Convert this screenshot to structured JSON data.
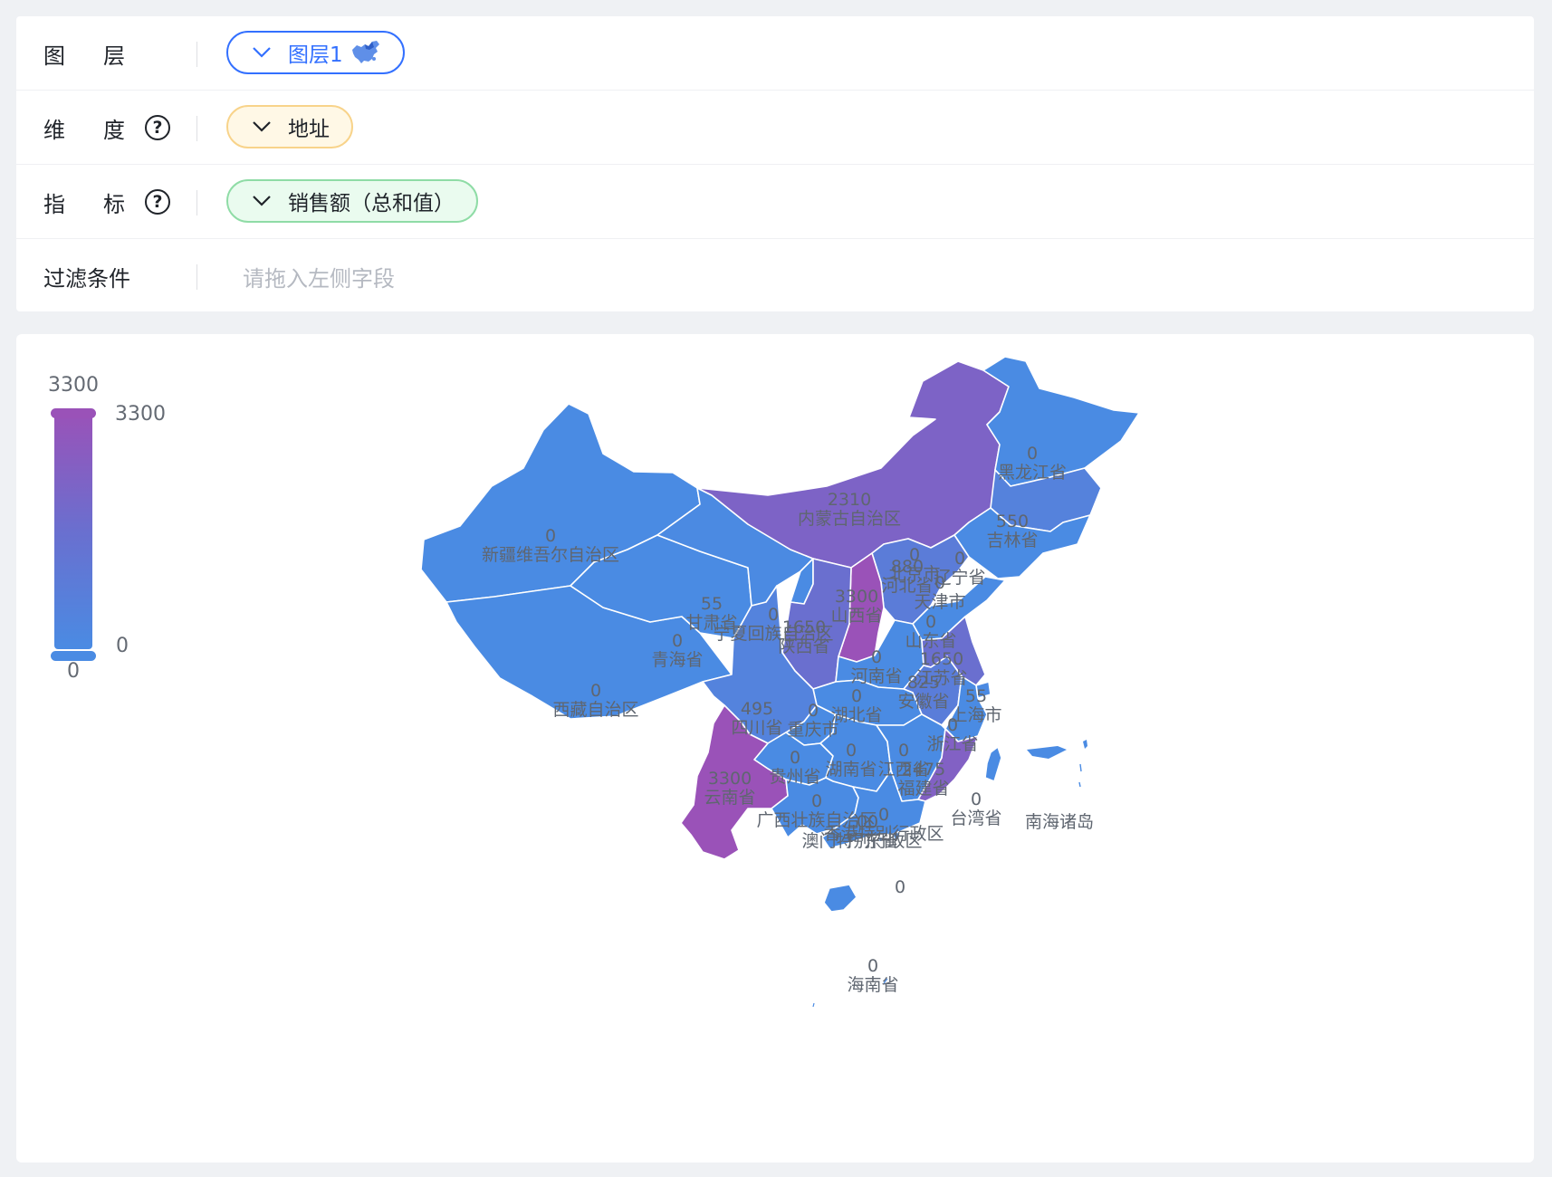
{
  "config": {
    "layer": {
      "label": "图层",
      "value": "图层1",
      "icon": "china-map-icon"
    },
    "dimension": {
      "label": "维度",
      "value": "地址",
      "help_icon": "question-circle-icon"
    },
    "metric": {
      "label": "指标",
      "value": "销售额（总和值）",
      "help_icon": "question-circle-icon"
    },
    "filter": {
      "label": "过滤条件",
      "placeholder": "请拖入左侧字段"
    }
  },
  "colors": {
    "low": "#4a8be3",
    "mid": "#6a6fcf",
    "high": "#9a52b8",
    "accent": "#3370ff",
    "border": "#ffffff"
  },
  "chart_data": {
    "type": "map",
    "legend": {
      "type": "continuous",
      "min": 0,
      "max": 3300,
      "top_label": "3300",
      "bottom_label": "0",
      "handle_max": "3300",
      "handle_min": "0"
    },
    "regions": [
      {
        "name": "新疆维吾尔自治区",
        "value": 0
      },
      {
        "name": "西藏自治区",
        "value": 0
      },
      {
        "name": "青海省",
        "value": 0
      },
      {
        "name": "甘肃省",
        "value": 55
      },
      {
        "name": "内蒙古自治区",
        "value": 2310
      },
      {
        "name": "黑龙江省",
        "value": 0
      },
      {
        "name": "吉林省",
        "value": 550
      },
      {
        "name": "辽宁省",
        "value": 0
      },
      {
        "name": "北京市",
        "value": 0
      },
      {
        "name": "天津市",
        "value": 0
      },
      {
        "name": "河北省",
        "value": 880
      },
      {
        "name": "山西省",
        "value": 3300
      },
      {
        "name": "宁夏回族自治区",
        "value": 0
      },
      {
        "name": "陕西省",
        "value": 1650
      },
      {
        "name": "山东省",
        "value": 0
      },
      {
        "name": "河南省",
        "value": 0
      },
      {
        "name": "江苏省",
        "value": 1650
      },
      {
        "name": "安徽省",
        "value": 825
      },
      {
        "name": "上海市",
        "value": 55
      },
      {
        "name": "浙江省",
        "value": 0
      },
      {
        "name": "湖北省",
        "value": 0
      },
      {
        "name": "四川省",
        "value": 495
      },
      {
        "name": "重庆市",
        "value": 0
      },
      {
        "name": "贵州省",
        "value": 0
      },
      {
        "name": "湖南省",
        "value": 0
      },
      {
        "name": "江西省",
        "value": 0
      },
      {
        "name": "福建省",
        "value": 2475
      },
      {
        "name": "云南省",
        "value": 3300
      },
      {
        "name": "广西壮族自治区",
        "value": 0
      },
      {
        "name": "广东省",
        "value": 0
      },
      {
        "name": "香港特别行政区",
        "value": 0
      },
      {
        "name": "澳门特别行政区",
        "value": 0
      },
      {
        "name": "台湾省",
        "value": 0
      },
      {
        "name": "海南省",
        "value": 0
      }
    ],
    "extra_labels": [
      "南海诸岛",
      "0"
    ]
  }
}
